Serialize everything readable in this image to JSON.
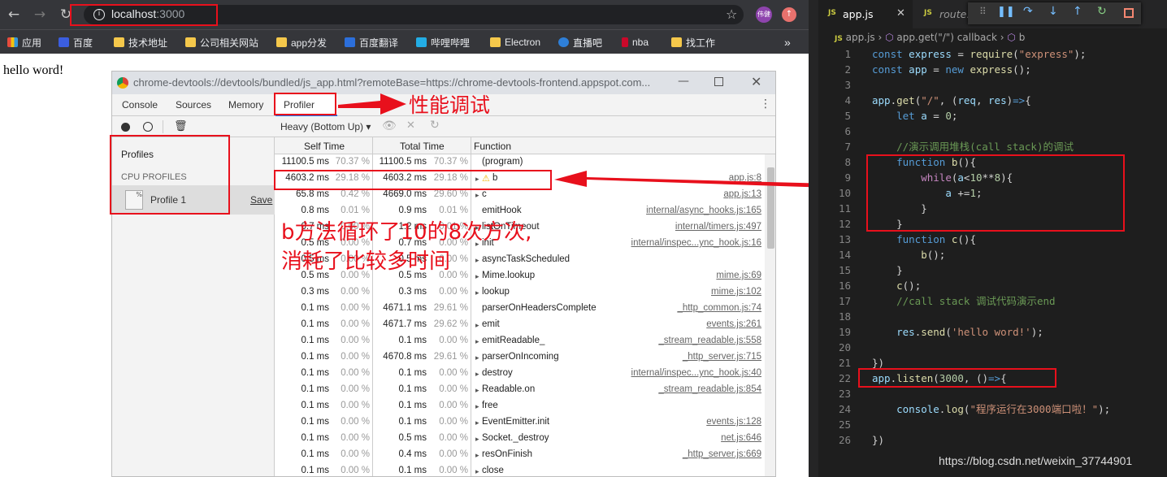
{
  "browser": {
    "url_host": "localhost",
    "url_port": ":3000",
    "avatar_label": "伟健",
    "bookmarks": [
      "应用",
      "百度",
      "技术地址",
      "公司相关网站",
      "app分发",
      "百度翻译",
      "哔哩哔哩",
      "Electron",
      "直播吧",
      "nba",
      "找工作"
    ],
    "more": "»"
  },
  "page": {
    "text": "hello word!"
  },
  "devtools": {
    "title": "chrome-devtools://devtools/bundled/js_app.html?remoteBase=https://chrome-devtools-frontend.appspot.com...",
    "tabs": [
      "Console",
      "Sources",
      "Memory",
      "Profiler"
    ],
    "view_mode": "Heavy (Bottom Up)",
    "sidebar": {
      "profiles": "Profiles",
      "cpu_profiles": "CPU PROFILES",
      "profile_item": "Profile 1",
      "save": "Save"
    },
    "columns": {
      "self_time": "Self Time",
      "total_time": "Total Time",
      "function": "Function"
    },
    "rows": [
      {
        "self": "11100.5 ms",
        "self_pct": "70.37 %",
        "total": "11100.5 ms",
        "total_pct": "70.37 %",
        "fn": "(program)",
        "src": "",
        "tri": ""
      },
      {
        "self": "4603.2 ms",
        "self_pct": "29.18 %",
        "total": "4603.2 ms",
        "total_pct": "29.18 %",
        "fn": "b",
        "src": "app.js:8",
        "tri": "▸"
      },
      {
        "self": "65.8 ms",
        "self_pct": "0.42 %",
        "total": "4669.0 ms",
        "total_pct": "29.60 %",
        "fn": "c",
        "src": "app.js:13",
        "tri": "▸"
      },
      {
        "self": "0.8 ms",
        "self_pct": "0.01 %",
        "total": "0.9 ms",
        "total_pct": "0.01 %",
        "fn": "emitHook",
        "src": "internal/async_hooks.js:165",
        "tri": ""
      },
      {
        "self": "0.7 ms",
        "self_pct": "0.00 %",
        "total": "1.2 ms",
        "total_pct": "0.01 %",
        "fn": "listOnTimeout",
        "src": "internal/timers.js:497",
        "tri": "▸"
      },
      {
        "self": "0.5 ms",
        "self_pct": "0.00 %",
        "total": "0.7 ms",
        "total_pct": "0.00 %",
        "fn": "init",
        "src": "internal/inspec...ync_hook.js:16",
        "tri": "▸"
      },
      {
        "self": "0.5 ms",
        "self_pct": "0.00 %",
        "total": "0.5 ms",
        "total_pct": "0.00 %",
        "fn": "asyncTaskScheduled",
        "src": "",
        "tri": "▸"
      },
      {
        "self": "0.5 ms",
        "self_pct": "0.00 %",
        "total": "0.5 ms",
        "total_pct": "0.00 %",
        "fn": "Mime.lookup",
        "src": "mime.js:69",
        "tri": "▸"
      },
      {
        "self": "0.3 ms",
        "self_pct": "0.00 %",
        "total": "0.3 ms",
        "total_pct": "0.00 %",
        "fn": "lookup",
        "src": "mime.js:102",
        "tri": "▸"
      },
      {
        "self": "0.1 ms",
        "self_pct": "0.00 %",
        "total": "4671.1 ms",
        "total_pct": "29.61 %",
        "fn": "parserOnHeadersComplete",
        "src": "_http_common.js:74",
        "tri": ""
      },
      {
        "self": "0.1 ms",
        "self_pct": "0.00 %",
        "total": "4671.7 ms",
        "total_pct": "29.62 %",
        "fn": "emit",
        "src": "events.js:261",
        "tri": "▸"
      },
      {
        "self": "0.1 ms",
        "self_pct": "0.00 %",
        "total": "0.1 ms",
        "total_pct": "0.00 %",
        "fn": "emitReadable_",
        "src": "_stream_readable.js:558",
        "tri": "▸"
      },
      {
        "self": "0.1 ms",
        "self_pct": "0.00 %",
        "total": "4670.8 ms",
        "total_pct": "29.61 %",
        "fn": "parserOnIncoming",
        "src": "_http_server.js:715",
        "tri": "▸"
      },
      {
        "self": "0.1 ms",
        "self_pct": "0.00 %",
        "total": "0.1 ms",
        "total_pct": "0.00 %",
        "fn": "destroy",
        "src": "internal/inspec...ync_hook.js:40",
        "tri": "▸"
      },
      {
        "self": "0.1 ms",
        "self_pct": "0.00 %",
        "total": "0.1 ms",
        "total_pct": "0.00 %",
        "fn": "Readable.on",
        "src": "_stream_readable.js:854",
        "tri": "▸"
      },
      {
        "self": "0.1 ms",
        "self_pct": "0.00 %",
        "total": "0.1 ms",
        "total_pct": "0.00 %",
        "fn": "free",
        "src": "",
        "tri": "▸"
      },
      {
        "self": "0.1 ms",
        "self_pct": "0.00 %",
        "total": "0.1 ms",
        "total_pct": "0.00 %",
        "fn": "EventEmitter.init",
        "src": "events.js:128",
        "tri": "▸"
      },
      {
        "self": "0.1 ms",
        "self_pct": "0.00 %",
        "total": "0.5 ms",
        "total_pct": "0.00 %",
        "fn": "Socket._destroy",
        "src": "net.js:646",
        "tri": "▸"
      },
      {
        "self": "0.1 ms",
        "self_pct": "0.00 %",
        "total": "0.4 ms",
        "total_pct": "0.00 %",
        "fn": "resOnFinish",
        "src": "_http_server.js:669",
        "tri": "▸"
      },
      {
        "self": "0.1 ms",
        "self_pct": "0.00 %",
        "total": "0.1 ms",
        "total_pct": "0.00 %",
        "fn": "close",
        "src": "",
        "tri": "▸"
      }
    ]
  },
  "annotations": {
    "profiler_note": "性能调试",
    "b_note_line1": "b方法循环了10的8次方次,",
    "b_note_line2": "消耗了比较多时间"
  },
  "editor": {
    "tabs": [
      "app.js",
      "route.js"
    ],
    "breadcrumb": [
      "app.js",
      "app.get(\"/\") callback",
      "b"
    ],
    "watermark": "https://blog.csdn.net/weixin_37744901"
  },
  "colors": {
    "annotation": "#e8101c",
    "chrome_bar": "#35363a",
    "editor_bg": "#1e1e1e"
  }
}
